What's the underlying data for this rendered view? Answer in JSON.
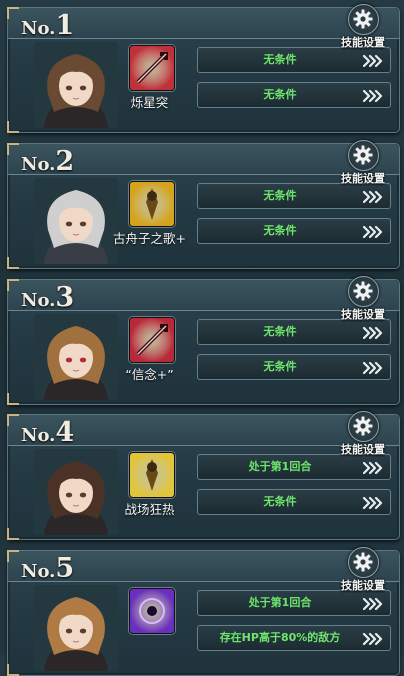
{
  "gear_label": "技能设置",
  "cards": [
    {
      "no_prefix": "No.",
      "no": "1",
      "skill_name": "烁星突",
      "conditions": [
        "无条件",
        "无条件"
      ],
      "skill_color": "#c0303a",
      "portrait_hair": "#6a4a33"
    },
    {
      "no_prefix": "No.",
      "no": "2",
      "skill_name": "古舟子之歌+",
      "conditions": [
        "无条件",
        "无条件"
      ],
      "skill_color": "#d4a21d",
      "portrait_hair": "#cfcfcf"
    },
    {
      "no_prefix": "No.",
      "no": "3",
      "skill_name": "“信念+”",
      "conditions": [
        "无条件",
        "无条件"
      ],
      "skill_color": "#b8283a",
      "portrait_hair": "#a0703e"
    },
    {
      "no_prefix": "No.",
      "no": "4",
      "skill_name": "战场狂热",
      "conditions": [
        "处于第1回合",
        "无条件"
      ],
      "skill_color": "#e0c43a",
      "portrait_hair": "#4a3226"
    },
    {
      "no_prefix": "No.",
      "no": "5",
      "skill_name": "",
      "conditions": [
        "处于第1回合",
        "存在HP高于80%的敌方"
      ],
      "skill_color": "#6a2fc0",
      "portrait_hair": "#b07a44"
    }
  ]
}
